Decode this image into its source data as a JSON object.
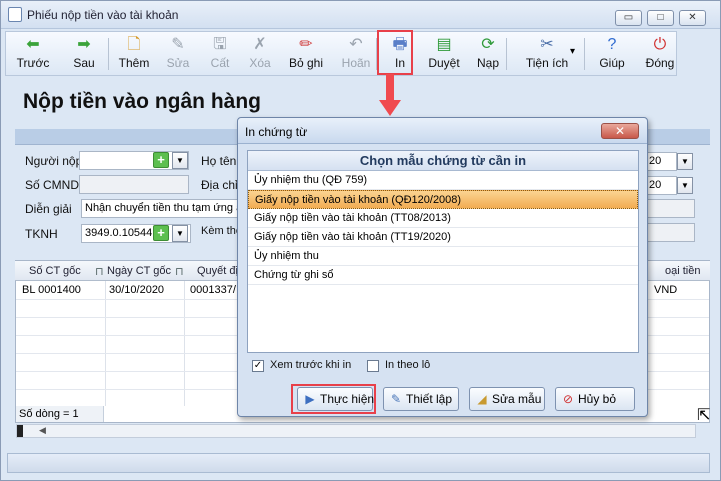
{
  "window": {
    "title": "Phiếu nộp tiền vào tài khoản",
    "controls": {
      "minimize": "▭",
      "maximize": "□",
      "close": "✕"
    }
  },
  "toolbar": {
    "items": [
      {
        "label": "Trước",
        "icon": "arrow-left-icon",
        "glyph": "⬅",
        "color": "#3aa33a"
      },
      {
        "label": "Sau",
        "icon": "arrow-right-icon",
        "glyph": "➡",
        "color": "#3aa33a"
      },
      {
        "label": "Thêm",
        "icon": "new-doc-icon",
        "glyph": "🗋",
        "color": "#d79b2a"
      },
      {
        "label": "Sửa",
        "icon": "edit-icon",
        "glyph": "✎",
        "color": "#9aa3ae"
      },
      {
        "label": "Cất",
        "icon": "save-icon",
        "glyph": "🖫",
        "color": "#9aa3ae"
      },
      {
        "label": "Xóa",
        "icon": "delete-icon",
        "glyph": "✗",
        "color": "#9aa3ae"
      },
      {
        "label": "Bỏ ghi",
        "icon": "unpost-icon",
        "glyph": "✏",
        "color": "#d04040"
      },
      {
        "label": "Hoãn",
        "icon": "undo-icon",
        "glyph": "↶",
        "color": "#9aa3ae"
      },
      {
        "label": "In",
        "icon": "print-icon",
        "glyph": "🖶",
        "color": "#5a7fc8"
      },
      {
        "label": "Duyệt",
        "icon": "browse-icon",
        "glyph": "▤",
        "color": "#2f9a3a"
      },
      {
        "label": "Nạp",
        "icon": "reload-icon",
        "glyph": "⟳",
        "color": "#2f9a3a"
      },
      {
        "label": "Tiện ích",
        "icon": "tools-icon",
        "glyph": "✂",
        "color": "#4a6ea8"
      },
      {
        "label": "Giúp",
        "icon": "help-icon",
        "glyph": "?",
        "color": "#2f6bd0"
      },
      {
        "label": "Đóng",
        "icon": "close-icon",
        "glyph": "⏻",
        "color": "#d03030"
      }
    ],
    "dropdown_glyph": "▾"
  },
  "page": {
    "title": "Nộp tiền vào ngân hàng"
  },
  "form": {
    "nguoi_nop_label": "Người nộp",
    "so_cmnd_label": "Số CMND",
    "dien_giai_label": "Diễn giải",
    "dien_giai_value": "Nhận chuyển tiền thu tạm ứng a",
    "tknh_label": "TKNH",
    "tknh_value": "3949.0.10544",
    "ho_ten_label": "Họ tên",
    "dia_chi_label": "Địa chỉ",
    "kem_theo_label": "Kèm the",
    "right_num_1": "20",
    "right_num_2": "20",
    "plus": "+",
    "dd": "▼"
  },
  "grid": {
    "headers": [
      "Số CT gốc",
      "Ngày CT gốc",
      "Quyết đị",
      "oại tiền"
    ],
    "pin": "⊓",
    "row": {
      "so_ct": "BL 0001400",
      "ngay": "30/10/2020",
      "qd": "0001337/",
      "loai_tien": "VND"
    },
    "row_count": "Số dòng = 1",
    "scroll_left": "◀"
  },
  "dialog": {
    "title": "In chứng từ",
    "close": "✕",
    "list_header": "Chọn mẫu chứng từ cần in",
    "items": [
      "Ủy nhiệm thu (QĐ 759)",
      "Giấy nộp tiền vào tài khoản (QĐ120/2008)",
      "Giấy nộp tiền vào tài khoản (TT08/2013)",
      "Giấy nộp tiền vào tài khoản (TT19/2020)",
      "Ủy nhiệm thu",
      "Chứng từ ghi sổ"
    ],
    "selected_index": 1,
    "preview_label": "Xem trước khi in",
    "preview_checked": "✓",
    "batch_label": "In theo lô",
    "buttons": {
      "execute": "Thực hiện",
      "setup": "Thiết lập",
      "edit": "Sửa mẫu",
      "cancel": "Hủy bỏ"
    }
  },
  "cursor": "⇱"
}
